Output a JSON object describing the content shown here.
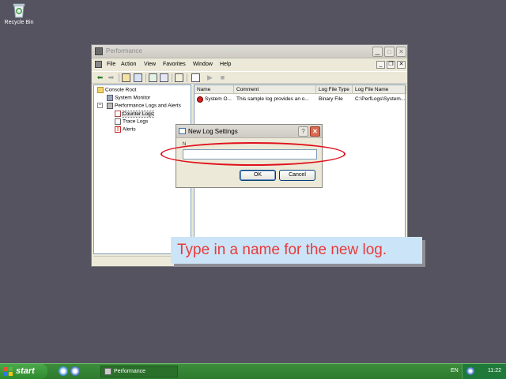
{
  "desktop": {
    "recycle_bin_label": "Recycle Bin"
  },
  "window": {
    "title": "Performance",
    "menu": [
      "File",
      "Action",
      "View",
      "Favorites",
      "Window",
      "Help"
    ],
    "tree": {
      "root": "Console Root",
      "system_monitor": "System Monitor",
      "logs_and_alerts": "Performance Logs and Alerts",
      "counter_logs": "Counter Logs",
      "trace_logs": "Trace Logs",
      "alerts": "Alerts"
    },
    "list": {
      "columns": [
        "Name",
        "Comment",
        "Log File Type",
        "Log File Name"
      ],
      "rows": [
        {
          "name": "System O...",
          "comment": "This sample log provides an o...",
          "type": "Binary File",
          "file": "C:\\PerfLogs\\System..."
        }
      ]
    }
  },
  "dialog": {
    "title": "New Log Settings",
    "help_glyph": "?",
    "close_glyph": "✕",
    "name_label": "N",
    "name_value": "",
    "ok_label": "OK",
    "cancel_label": "Cancel"
  },
  "caption": "Type in a name for the new log.",
  "taskbar": {
    "start_label": "start",
    "task_label": "Performance",
    "language": "EN",
    "clock": "11:22"
  },
  "colors": {
    "desktop": "#54535f",
    "highlight": "#e0101a",
    "caption_bg": "#cce4f7",
    "caption_text": "#e83a3a"
  }
}
